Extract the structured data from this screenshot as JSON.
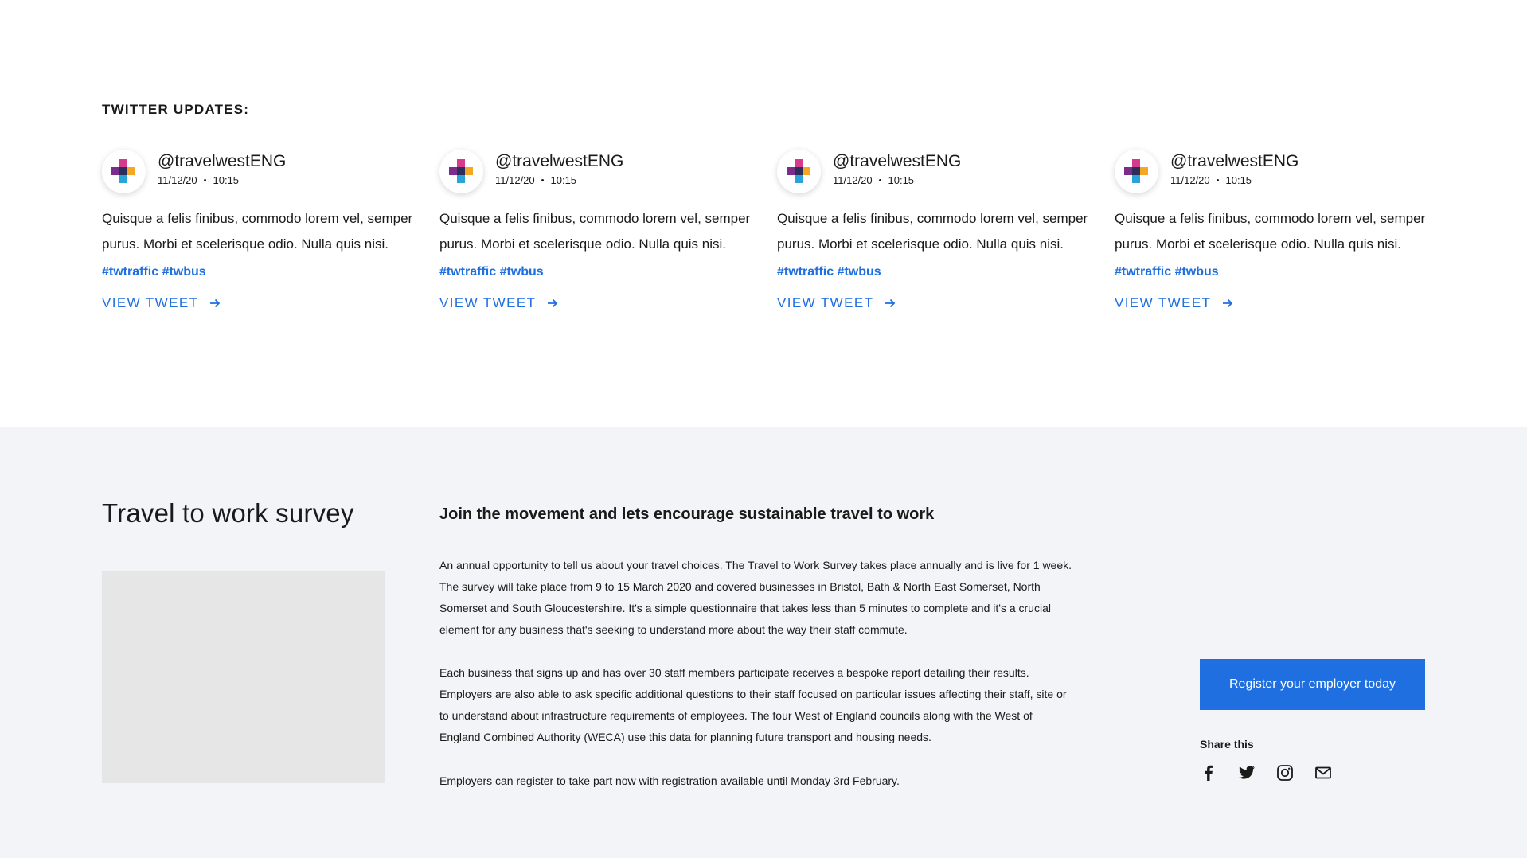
{
  "twitter": {
    "heading": "TWITTER UPDATES:",
    "tweets": [
      {
        "handle": "@travelwestENG",
        "date": "11/12/20",
        "time": "10:15",
        "body": "Quisque a felis finibus, commodo lorem vel, semper purus. Morbi et scelerisque odio. Nulla quis nisi.",
        "tags": "#twtraffic #twbus",
        "link": "VIEW TWEET"
      },
      {
        "handle": "@travelwestENG",
        "date": "11/12/20",
        "time": "10:15",
        "body": "Quisque a felis finibus, commodo lorem vel, semper purus. Morbi et scelerisque odio. Nulla quis nisi.",
        "tags": "#twtraffic #twbus",
        "link": "VIEW TWEET"
      },
      {
        "handle": "@travelwestENG",
        "date": "11/12/20",
        "time": "10:15",
        "body": "Quisque a felis finibus, commodo lorem vel, semper purus. Morbi et scelerisque odio. Nulla quis nisi.",
        "tags": "#twtraffic #twbus",
        "link": "VIEW TWEET"
      },
      {
        "handle": "@travelwestENG",
        "date": "11/12/20",
        "time": "10:15",
        "body": "Quisque a felis finibus, commodo lorem vel, semper purus. Morbi et scelerisque odio. Nulla quis nisi.",
        "tags": "#twtraffic #twbus",
        "link": "VIEW TWEET"
      }
    ]
  },
  "survey": {
    "title": "Travel to work survey",
    "subtitle": "Join the movement and lets encourage sustainable travel to work",
    "paragraphs": [
      "An annual opportunity to tell us about your travel choices. The Travel to Work Survey takes place annually and is live for 1 week. The survey will take place from 9 to 15 March 2020 and covered businesses in Bristol, Bath & North East Somerset, North Somerset and South Gloucestershire. It's a simple questionnaire that takes less than 5 minutes to complete and it's a crucial element for any business that's seeking to understand more about the way their staff commute.",
      "Each business that signs up and has over 30 staff members participate receives a bespoke report detailing their results. Employers are also able to ask specific additional questions to their staff focused on particular issues affecting their staff, site or to understand about infrastructure requirements of employees. The four West of England councils along with the West of England Combined Authority (WECA) use this data for planning future transport and housing needs.",
      "Employers can register to take part now with registration available until Monday 3rd February."
    ],
    "register_button": "Register your employer today",
    "share_label": "Share this",
    "share_icons": [
      "facebook-icon",
      "twitter-icon",
      "instagram-icon",
      "email-icon"
    ]
  },
  "colors": {
    "accent": "#1f6fe0",
    "survey_background": "#f3f4f7",
    "image_placeholder": "#e6e6e6",
    "logo_magenta": "#d63a8a",
    "logo_purple": "#7b2d8e",
    "logo_orange": "#f5a623",
    "logo_blue": "#2aa3d8",
    "logo_navy": "#2b2d5a"
  }
}
